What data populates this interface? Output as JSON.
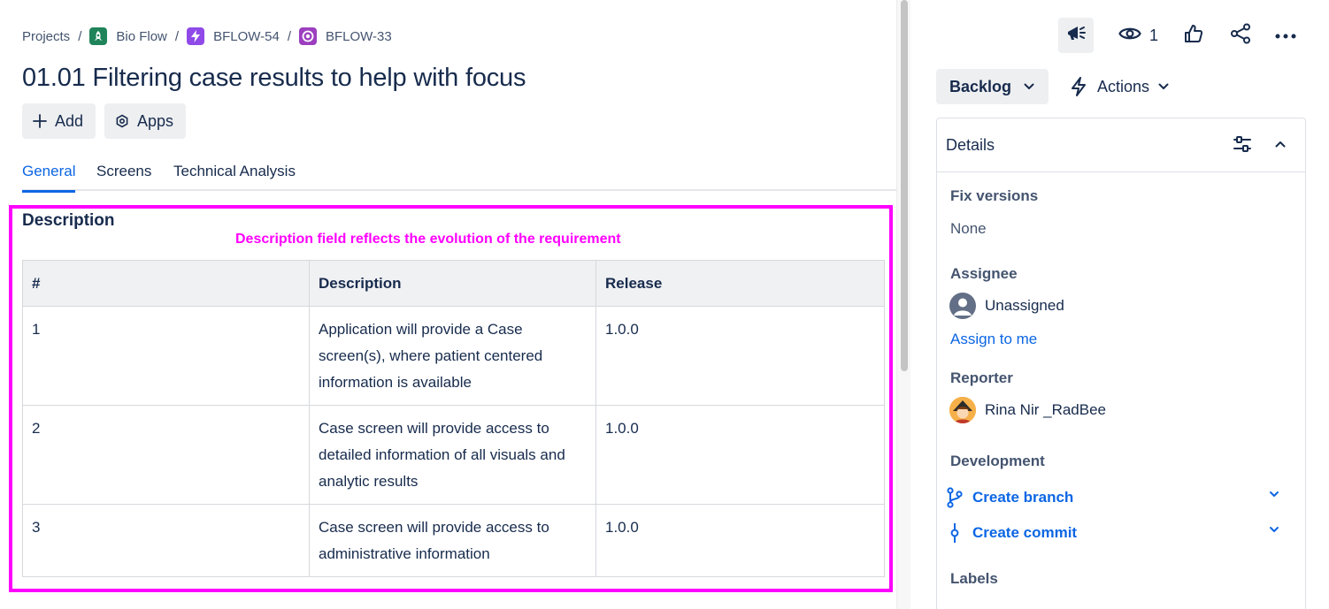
{
  "breadcrumb": {
    "items": [
      {
        "label": "Projects",
        "icon": "none"
      },
      {
        "label": "Bio Flow",
        "icon": "rocket-icon",
        "color": "#1f845a"
      },
      {
        "label": "BFLOW-54",
        "icon": "epic-bolt-icon",
        "color": "#8f4ae8"
      },
      {
        "label": "BFLOW-33",
        "icon": "feature-icon",
        "color": "#9c3fbf"
      }
    ],
    "separator": "/"
  },
  "issue": {
    "title": "01.01 Filtering case results to help with focus"
  },
  "toolbar": {
    "add_label": "Add",
    "apps_label": "Apps"
  },
  "tabs": [
    {
      "label": "General",
      "active": true
    },
    {
      "label": "Screens",
      "active": false
    },
    {
      "label": "Technical Analysis",
      "active": false
    }
  ],
  "description": {
    "heading": "Description",
    "annotation": "Description field reflects the evolution of the requirement",
    "annotation_color": "#ff00ff",
    "columns": [
      "#",
      "Description",
      "Release"
    ],
    "rows": [
      {
        "num": "1",
        "text": "Application will provide a Case screen(s), where patient centered information is available",
        "release": "1.0.0"
      },
      {
        "num": "2",
        "text": "Case screen will provide access to detailed information of all visuals and analytic results",
        "release": "1.0.0"
      },
      {
        "num": "3",
        "text": "Case screen will provide access to administrative information",
        "release": "1.0.0"
      }
    ]
  },
  "top_actions": {
    "watch_count": "1"
  },
  "status": {
    "label": "Backlog",
    "actions_label": "Actions"
  },
  "details": {
    "title": "Details",
    "fix_versions_label": "Fix versions",
    "fix_versions_value": "None",
    "assignee_label": "Assignee",
    "assignee_value": "Unassigned",
    "assign_to_me": "Assign to me",
    "reporter_label": "Reporter",
    "reporter_value": "Rina Nir _RadBee",
    "development_label": "Development",
    "create_branch": "Create branch",
    "create_commit": "Create commit",
    "labels_label": "Labels"
  },
  "colors": {
    "link": "#0c66e4",
    "highlight": "#ff00ff",
    "text": "#172b4d"
  }
}
